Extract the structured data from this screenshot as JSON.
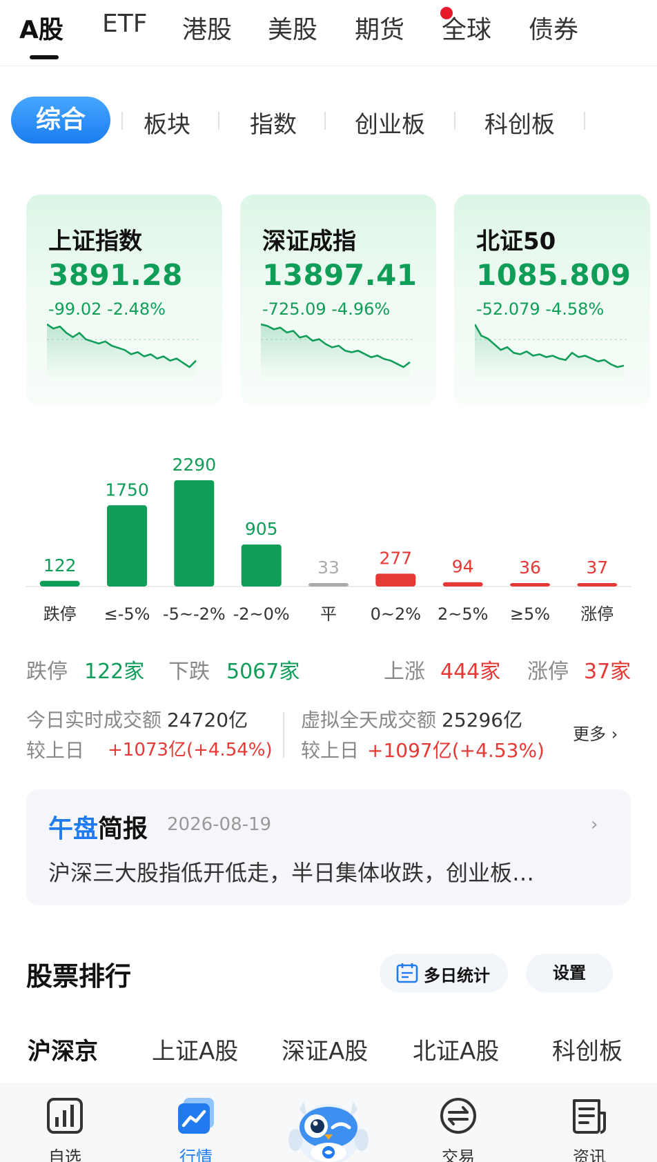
{
  "market_tabs": [
    {
      "label": "A股",
      "active": true
    },
    {
      "label": "ETF",
      "active": false
    },
    {
      "label": "港股",
      "active": false
    },
    {
      "label": "美股",
      "active": false
    },
    {
      "label": "期货",
      "active": false,
      "badge": "red-dot"
    },
    {
      "label": "全球",
      "active": false
    },
    {
      "label": "债券",
      "active": false
    }
  ],
  "sub_tabs": [
    {
      "label": "综合",
      "active": true
    },
    {
      "label": "板块",
      "active": false
    },
    {
      "label": "指数",
      "active": false
    },
    {
      "label": "创业板",
      "active": false
    },
    {
      "label": "科创板",
      "active": false
    }
  ],
  "index_cards": [
    {
      "name": "上证指数",
      "value": "3891.28",
      "change": "-99.02 -2.48%",
      "trend": [
        100,
        98,
        99,
        96,
        94,
        96,
        93,
        92,
        91,
        92,
        90,
        89,
        88,
        86,
        87,
        85,
        86,
        84,
        85,
        83,
        84,
        82,
        80,
        83
      ]
    },
    {
      "name": "深证成指",
      "value": "13897.41",
      "change": "-725.09 -4.96%",
      "trend": [
        100,
        99,
        97,
        98,
        95,
        96,
        92,
        93,
        90,
        91,
        88,
        86,
        87,
        84,
        83,
        84,
        82,
        80,
        81,
        79,
        78,
        76,
        74,
        77
      ]
    },
    {
      "name": "北证50",
      "value": "1085.809",
      "change": "-52.079 -4.58%",
      "trend": [
        100,
        92,
        90,
        86,
        82,
        84,
        80,
        79,
        81,
        78,
        79,
        77,
        78,
        76,
        75,
        80,
        77,
        78,
        76,
        74,
        75,
        72,
        70,
        71
      ]
    }
  ],
  "colors": {
    "up": "#e53935",
    "down": "#0f9d58",
    "flat": "#aaaaaa",
    "accent": "#1f7bef"
  },
  "chart_data": {
    "type": "bar",
    "categories": [
      "跌停",
      "≤-5%",
      "-5~-2%",
      "-2~0%",
      "平",
      "0~2%",
      "2~5%",
      "≥5%",
      "涨停"
    ],
    "values": [
      122,
      1750,
      2290,
      905,
      33,
      277,
      94,
      36,
      37
    ],
    "value_labels": [
      "122",
      "1750",
      "2290",
      "905",
      "33",
      "277",
      "94",
      "36",
      "37"
    ],
    "bar_colors": [
      "#0f9d58",
      "#0f9d58",
      "#0f9d58",
      "#0f9d58",
      "#aaaaaa",
      "#e53935",
      "#e53935",
      "#e53935",
      "#e53935"
    ]
  },
  "summary": {
    "limit_down_label": "跌停",
    "limit_down_value": "122家",
    "down_label": "下跌",
    "down_value": "5067家",
    "up_label": "上涨",
    "up_value": "444家",
    "limit_up_label": "涨停",
    "limit_up_value": "37家"
  },
  "turnover": {
    "realtime_label": "今日实时成交额",
    "realtime_value": "24720亿",
    "realtime_cmp_label": "较上日",
    "realtime_cmp_value": "+1073亿(+4.54%)",
    "virtual_label": "虚拟全天成交额",
    "virtual_value": "25296亿",
    "virtual_cmp_label": "较上日",
    "virtual_cmp_value": "+1097亿(+4.53%)",
    "more_label": "更多 ›"
  },
  "brief": {
    "title_part1": "午盘",
    "title_part2": "简报",
    "date": "2026-08-19",
    "arrow": "›",
    "text": "沪深三大股指低开低走，半日集体收跌，创业板…"
  },
  "ranking": {
    "title": "股票排行",
    "multi_day_label": "多日统计",
    "settings_label": "设置",
    "tabs": [
      {
        "label": "沪深京",
        "active": true
      },
      {
        "label": "上证A股",
        "active": false
      },
      {
        "label": "深证A股",
        "active": false
      },
      {
        "label": "北证A股",
        "active": false
      },
      {
        "label": "科创板",
        "active": false
      }
    ]
  },
  "bottom_nav": [
    {
      "label": "自选",
      "icon": "bar-chart-icon",
      "active": false
    },
    {
      "label": "行情",
      "icon": "trend-chart-icon",
      "active": true
    },
    {
      "label": "",
      "icon": "owl-mascot-icon",
      "active": false
    },
    {
      "label": "交易",
      "icon": "exchange-icon",
      "active": false
    },
    {
      "label": "资讯",
      "icon": "news-icon",
      "active": false
    }
  ]
}
